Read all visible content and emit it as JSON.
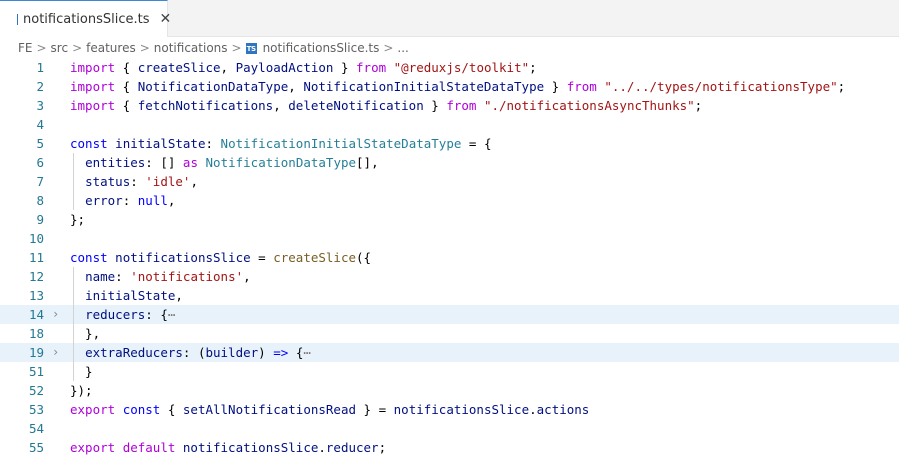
{
  "tab": {
    "icon_label": "TS",
    "filename": "notificationsSlice.ts",
    "close_glyph": "✕"
  },
  "breadcrumb": {
    "items": [
      "FE",
      "src",
      "features",
      "notifications",
      "notificationsSlice.ts",
      "..."
    ],
    "separator": ">"
  },
  "editor": {
    "lines": [
      {
        "num": "1",
        "tokens": [
          [
            "kw",
            "import"
          ],
          [
            "p",
            " { "
          ],
          [
            "var",
            "createSlice"
          ],
          [
            "p",
            ", "
          ],
          [
            "var",
            "PayloadAction"
          ],
          [
            "p",
            " } "
          ],
          [
            "kw",
            "from"
          ],
          [
            "p",
            " "
          ],
          [
            "str",
            "\"@reduxjs/toolkit\""
          ],
          [
            "p",
            ";"
          ]
        ]
      },
      {
        "num": "2",
        "tokens": [
          [
            "kw",
            "import"
          ],
          [
            "p",
            " { "
          ],
          [
            "var",
            "NotificationDataType"
          ],
          [
            "p",
            ", "
          ],
          [
            "var",
            "NotificationInitialStateDataType"
          ],
          [
            "p",
            " } "
          ],
          [
            "kw",
            "from"
          ],
          [
            "p",
            " "
          ],
          [
            "str",
            "\"../../types/notificationsType\""
          ],
          [
            "p",
            ";"
          ]
        ]
      },
      {
        "num": "3",
        "tokens": [
          [
            "kw",
            "import"
          ],
          [
            "p",
            " { "
          ],
          [
            "var",
            "fetchNotifications"
          ],
          [
            "p",
            ", "
          ],
          [
            "var",
            "deleteNotification"
          ],
          [
            "p",
            " } "
          ],
          [
            "kw",
            "from"
          ],
          [
            "p",
            " "
          ],
          [
            "str",
            "\"./notificationsAsyncThunks\""
          ],
          [
            "p",
            ";"
          ]
        ]
      },
      {
        "num": "4",
        "tokens": []
      },
      {
        "num": "5",
        "tokens": [
          [
            "kwb",
            "const"
          ],
          [
            "p",
            " "
          ],
          [
            "var",
            "initialState"
          ],
          [
            "p",
            ": "
          ],
          [
            "type",
            "NotificationInitialStateDataType"
          ],
          [
            "p",
            " = {"
          ]
        ]
      },
      {
        "num": "6",
        "guide": true,
        "tokens": [
          [
            "p",
            "  "
          ],
          [
            "var",
            "entities"
          ],
          [
            "p",
            ": [] "
          ],
          [
            "kw",
            "as"
          ],
          [
            "p",
            " "
          ],
          [
            "type",
            "NotificationDataType"
          ],
          [
            "p",
            "[],"
          ]
        ]
      },
      {
        "num": "7",
        "guide": true,
        "tokens": [
          [
            "p",
            "  "
          ],
          [
            "var",
            "status"
          ],
          [
            "p",
            ": "
          ],
          [
            "str",
            "'idle'"
          ],
          [
            "p",
            ","
          ]
        ]
      },
      {
        "num": "8",
        "guide": true,
        "tokens": [
          [
            "p",
            "  "
          ],
          [
            "var",
            "error"
          ],
          [
            "p",
            ": "
          ],
          [
            "kwb",
            "null"
          ],
          [
            "p",
            ","
          ]
        ]
      },
      {
        "num": "9",
        "tokens": [
          [
            "p",
            "};"
          ]
        ]
      },
      {
        "num": "10",
        "tokens": []
      },
      {
        "num": "11",
        "tokens": [
          [
            "kwb",
            "const"
          ],
          [
            "p",
            " "
          ],
          [
            "var",
            "notificationsSlice"
          ],
          [
            "p",
            " = "
          ],
          [
            "fn",
            "createSlice"
          ],
          [
            "p",
            "({"
          ]
        ]
      },
      {
        "num": "12",
        "guide": true,
        "tokens": [
          [
            "p",
            "  "
          ],
          [
            "var",
            "name"
          ],
          [
            "p",
            ": "
          ],
          [
            "str",
            "'notifications'"
          ],
          [
            "p",
            ","
          ]
        ]
      },
      {
        "num": "13",
        "guide": true,
        "tokens": [
          [
            "p",
            "  "
          ],
          [
            "var",
            "initialState"
          ],
          [
            "p",
            ","
          ]
        ]
      },
      {
        "num": "14",
        "guide": true,
        "highlight": true,
        "fold": "›",
        "tokens": [
          [
            "p",
            "  "
          ],
          [
            "var",
            "reducers"
          ],
          [
            "p",
            ": {"
          ],
          [
            "ell",
            "⋯"
          ]
        ]
      },
      {
        "num": "18",
        "guide": true,
        "tokens": [
          [
            "p",
            "  },"
          ]
        ]
      },
      {
        "num": "19",
        "guide": true,
        "highlight": true,
        "fold": "›",
        "tokens": [
          [
            "p",
            "  "
          ],
          [
            "var",
            "extraReducers"
          ],
          [
            "p",
            ": ("
          ],
          [
            "var",
            "builder"
          ],
          [
            "p",
            ") "
          ],
          [
            "kwb",
            "=>"
          ],
          [
            "p",
            " {"
          ],
          [
            "ell",
            "⋯"
          ]
        ]
      },
      {
        "num": "51",
        "guide": true,
        "tokens": [
          [
            "p",
            "  }"
          ]
        ]
      },
      {
        "num": "52",
        "tokens": [
          [
            "p",
            "});"
          ]
        ]
      },
      {
        "num": "53",
        "tokens": [
          [
            "kw",
            "export"
          ],
          [
            "p",
            " "
          ],
          [
            "kwb",
            "const"
          ],
          [
            "p",
            " { "
          ],
          [
            "var",
            "setAllNotificationsRead"
          ],
          [
            "p",
            " } = "
          ],
          [
            "var",
            "notificationsSlice"
          ],
          [
            "p",
            "."
          ],
          [
            "var",
            "actions"
          ]
        ]
      },
      {
        "num": "54",
        "tokens": []
      },
      {
        "num": "55",
        "tokens": [
          [
            "kw",
            "export"
          ],
          [
            "p",
            " "
          ],
          [
            "kw",
            "default"
          ],
          [
            "p",
            " "
          ],
          [
            "var",
            "notificationsSlice"
          ],
          [
            "p",
            "."
          ],
          [
            "var",
            "reducer"
          ],
          [
            "p",
            ";"
          ]
        ]
      }
    ]
  },
  "colors": {
    "keyword_import": "#af00db",
    "keyword_decl": "#0000ff",
    "variable": "#001080",
    "function": "#795e26",
    "type": "#267f99",
    "string": "#a31515",
    "line_number": "#237893",
    "highlight_bg": "#e8f2fb",
    "tab_active_border": "#3c8ad6",
    "ts_icon": "#2f75c0"
  }
}
